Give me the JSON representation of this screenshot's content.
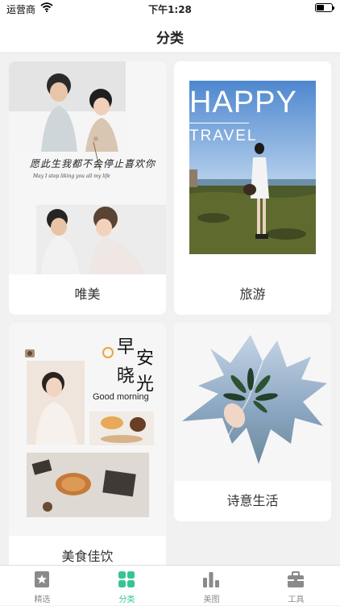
{
  "status": {
    "carrier": "运营商",
    "time": "下午1:28"
  },
  "header": {
    "title": "分类"
  },
  "categories": [
    {
      "label": "唯美",
      "artwork": {
        "calligraphy": "愿此生我都不会停止喜欢你",
        "caption": "May I stop liking you all my life"
      }
    },
    {
      "label": "旅游",
      "artwork": {
        "headline": "HAPPY",
        "subline": "TRAVEL"
      }
    },
    {
      "label": "诗意生活"
    },
    {
      "label": "美食佳饮",
      "artwork": {
        "char1": "早",
        "char2": "安",
        "char3": "晓",
        "char4": "光",
        "english": "Good morning"
      }
    }
  ],
  "tabbar": {
    "active_color": "#36c494",
    "items": [
      {
        "label": "精选",
        "icon": "star-icon"
      },
      {
        "label": "分类",
        "icon": "grid-icon"
      },
      {
        "label": "美图",
        "icon": "bar-chart-icon"
      },
      {
        "label": "工具",
        "icon": "toolbox-icon"
      }
    ]
  }
}
